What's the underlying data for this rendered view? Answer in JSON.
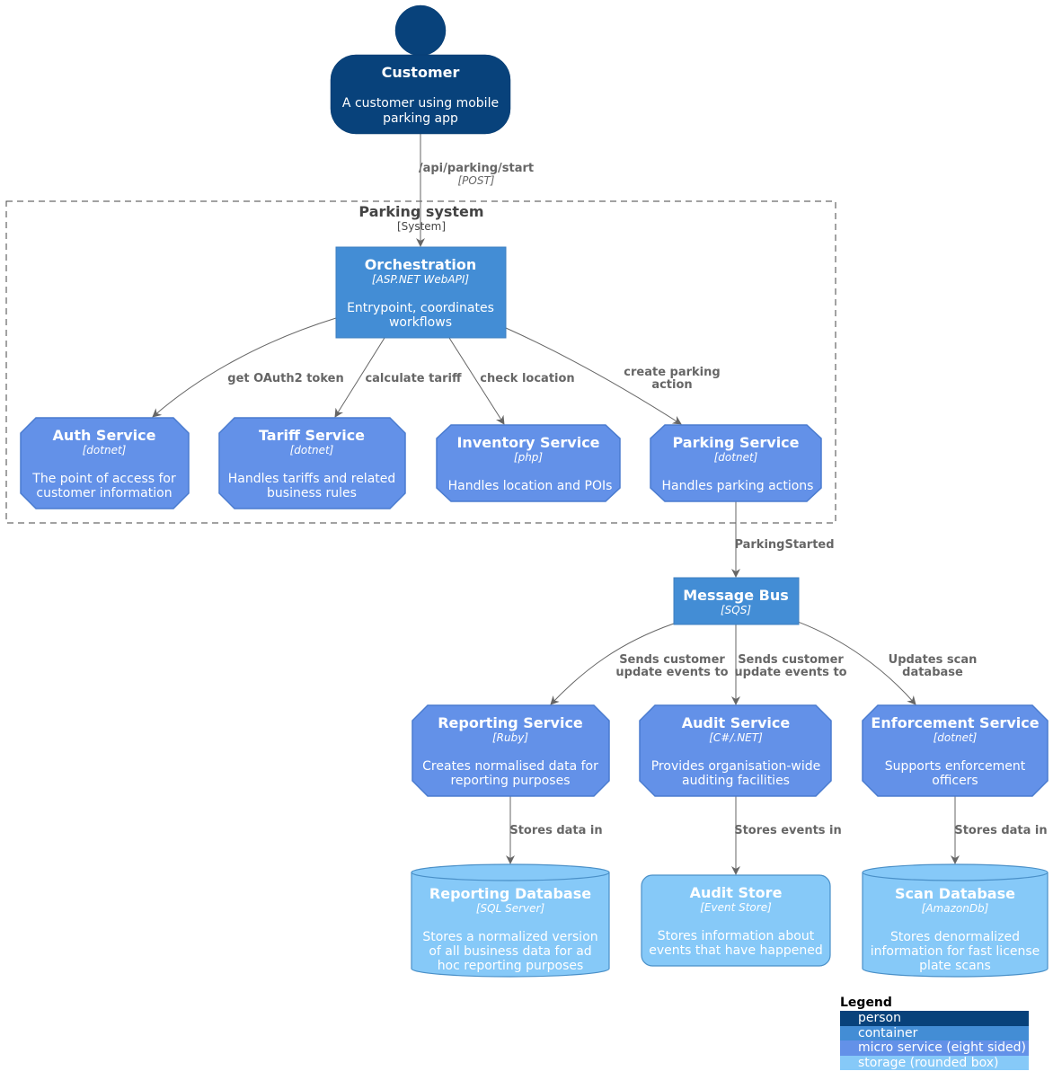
{
  "colors": {
    "person": "#08427B",
    "container": "#438DD5",
    "micro_service": "#6391E8",
    "storage": "#86C9F8",
    "edge": "#666666",
    "boundary": "#444444"
  },
  "person": {
    "title": "Customer",
    "description": [
      "A customer using mobile",
      "parking app"
    ]
  },
  "boundary": {
    "title": "Parking system",
    "type": "[System]"
  },
  "nodes": {
    "orchestration": {
      "title": "Orchestration",
      "tech": "[ASP.NET WebAPI]",
      "description": [
        "Entrypoint, coordinates",
        "workflows"
      ]
    },
    "auth": {
      "title": "Auth Service",
      "tech": "[dotnet]",
      "description": [
        "The point of access for",
        "customer information"
      ]
    },
    "tariff": {
      "title": "Tariff Service",
      "tech": "[dotnet]",
      "description": [
        "Handles tariffs and related",
        "business rules"
      ]
    },
    "inventory": {
      "title": "Inventory Service",
      "tech": "[php]",
      "description": [
        "Handles location and POIs"
      ]
    },
    "parking": {
      "title": "Parking Service",
      "tech": "[dotnet]",
      "description": [
        "Handles parking actions"
      ]
    },
    "bus": {
      "title": "Message Bus",
      "tech": "[SQS]",
      "description": []
    },
    "reporting": {
      "title": "Reporting Service",
      "tech": "[Ruby]",
      "description": [
        "Creates normalised data for",
        "reporting purposes"
      ]
    },
    "audit": {
      "title": "Audit Service",
      "tech": "[C#/.NET]",
      "description": [
        "Provides organisation-wide",
        "auditing facilities"
      ]
    },
    "enforcement": {
      "title": "Enforcement Service",
      "tech": "[dotnet]",
      "description": [
        "Supports enforcement",
        "officers"
      ]
    },
    "reportingdb": {
      "title": "Reporting Database",
      "tech": "[SQL Server]",
      "description": [
        "Stores a normalized version",
        "of all business data for ad",
        "hoc reporting purposes"
      ]
    },
    "auditstore": {
      "title": "Audit Store",
      "tech": "[Event Store]",
      "description": [
        "Stores information about",
        "events that have happened"
      ]
    },
    "scandb": {
      "title": "Scan Database",
      "tech": "[AmazonDb]",
      "description": [
        "Stores denormalized",
        "information for fast license",
        "plate scans"
      ]
    }
  },
  "edges": {
    "customer_orch": {
      "label": [
        "/api/parking/start"
      ],
      "tech": "[POST]"
    },
    "orch_auth": {
      "label": [
        "get OAuth2 token"
      ]
    },
    "orch_tariff": {
      "label": [
        "calculate tariff"
      ]
    },
    "orch_inventory": {
      "label": [
        "check location"
      ]
    },
    "orch_parking": {
      "label": [
        "create parking",
        "action"
      ]
    },
    "parking_bus": {
      "label": [
        "ParkingStarted"
      ]
    },
    "bus_reporting": {
      "label": [
        "Sends customer",
        "update events to"
      ]
    },
    "bus_audit": {
      "label": [
        "Sends customer",
        "update events to"
      ]
    },
    "bus_enforcement": {
      "label": [
        "Updates scan",
        "database"
      ]
    },
    "reporting_db": {
      "label": [
        "Stores data in"
      ]
    },
    "audit_store": {
      "label": [
        "Stores events in"
      ]
    },
    "enforcement_db": {
      "label": [
        "Stores data in"
      ]
    }
  },
  "legend": {
    "title": "Legend",
    "items": [
      {
        "label": "person",
        "color": "#08427B"
      },
      {
        "label": "container",
        "color": "#438DD5"
      },
      {
        "label": "micro service (eight sided)",
        "color": "#6391E8"
      },
      {
        "label": "storage (rounded box)",
        "color": "#86C9F8"
      }
    ]
  }
}
